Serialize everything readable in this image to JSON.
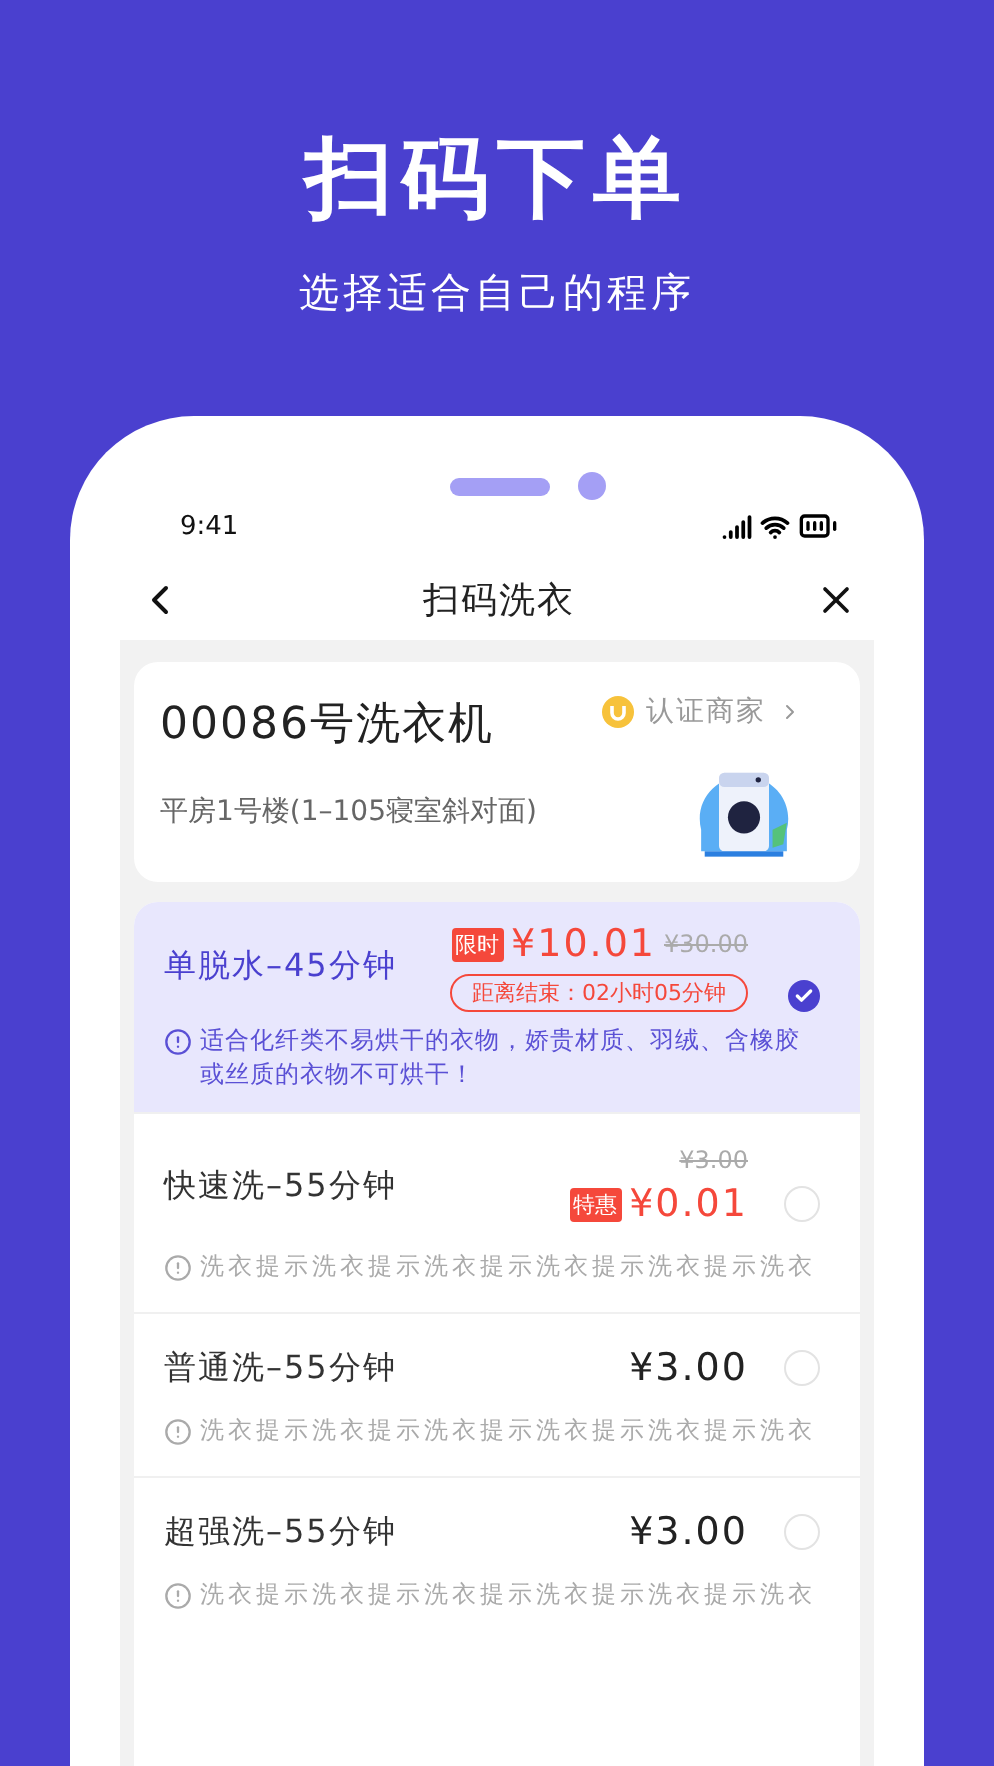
{
  "headline": "扫码下单",
  "subtitle": "选择适合自己的程序",
  "status_bar": {
    "time": "9:41"
  },
  "nav": {
    "title": "扫码洗衣"
  },
  "machine": {
    "name": "00086号洗衣机",
    "badge": "认证商家",
    "address": "平房1号楼(1–105寝室斜对面)"
  },
  "options": [
    {
      "kind": "promo",
      "name": "单脱水–45分钟",
      "selected": true,
      "tag": "限时",
      "price": "¥10.01",
      "original_price": "¥30.00",
      "countdown": "距离结束：02小时05分钟",
      "note": "适合化纤类不易烘干的衣物，娇贵材质、羽绒、含橡胶或丝质的衣物不可烘干！"
    },
    {
      "kind": "special",
      "name": "快速洗–55分钟",
      "selected": false,
      "tag": "特惠",
      "price": "¥0.01",
      "original_price": "¥3.00",
      "note": "洗衣提示洗衣提示洗衣提示洗衣提示洗衣提示洗衣"
    },
    {
      "kind": "normal",
      "name": "普通洗–55分钟",
      "selected": false,
      "price": "¥3.00",
      "note": "洗衣提示洗衣提示洗衣提示洗衣提示洗衣提示洗衣"
    },
    {
      "kind": "normal",
      "name": "超强洗–55分钟",
      "selected": false,
      "price": "¥3.00",
      "note": "洗衣提示洗衣提示洗衣提示洗衣提示洗衣提示洗衣"
    }
  ]
}
